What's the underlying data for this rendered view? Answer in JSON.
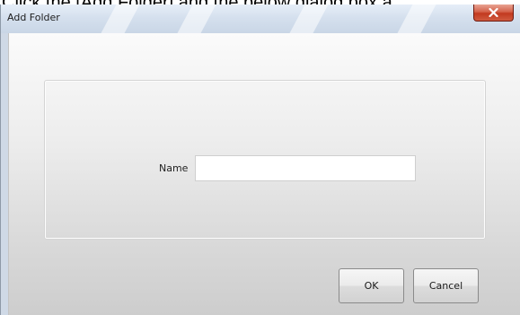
{
  "caption": "Click the [Add Folder] and the below dialog box a",
  "window": {
    "title": "Add Folder"
  },
  "icons": {
    "close": "close-icon"
  },
  "form": {
    "name_label": "Name",
    "name_value": "",
    "name_placeholder": ""
  },
  "buttons": {
    "ok_label": "OK",
    "cancel_label": "Cancel"
  },
  "colors": {
    "close_button": "#c2391f",
    "titlebar": "#d5e0ee",
    "content_background": "#ececec"
  }
}
